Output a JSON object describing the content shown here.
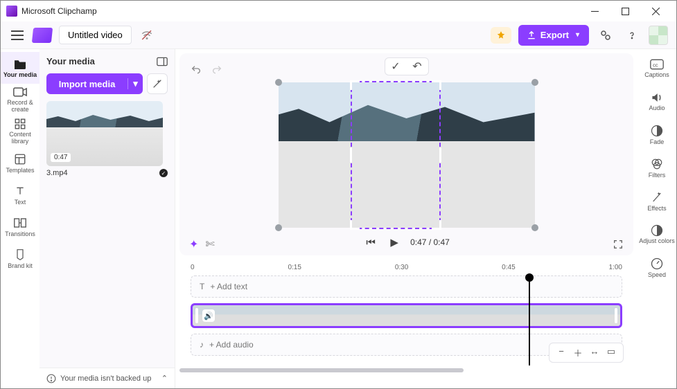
{
  "app": {
    "title": "Microsoft Clipchamp"
  },
  "toolbar": {
    "project_title": "Untitled video",
    "export_label": "Export"
  },
  "left_rail": {
    "items": [
      {
        "label": "Your media"
      },
      {
        "label": "Record & create"
      },
      {
        "label": "Content library"
      },
      {
        "label": "Templates"
      },
      {
        "label": "Text"
      },
      {
        "label": "Transitions"
      },
      {
        "label": "Brand kit"
      }
    ]
  },
  "media_panel": {
    "header": "Your media",
    "import_label": "Import media",
    "thumb_duration": "0:47",
    "file_name": "3.mp4",
    "backup_msg": "Your media isn't backed up"
  },
  "player": {
    "current_time": "0:47",
    "total_time": "0:47"
  },
  "timeline": {
    "marks": [
      "0",
      "0:15",
      "0:30",
      "0:45",
      "1:00"
    ],
    "text_track_hint": "+ Add text",
    "audio_track_hint": "+ Add audio"
  },
  "right_rail": {
    "items": [
      {
        "label": "Captions"
      },
      {
        "label": "Audio"
      },
      {
        "label": "Fade"
      },
      {
        "label": "Filters"
      },
      {
        "label": "Effects"
      },
      {
        "label": "Adjust colors"
      },
      {
        "label": "Speed"
      }
    ]
  }
}
